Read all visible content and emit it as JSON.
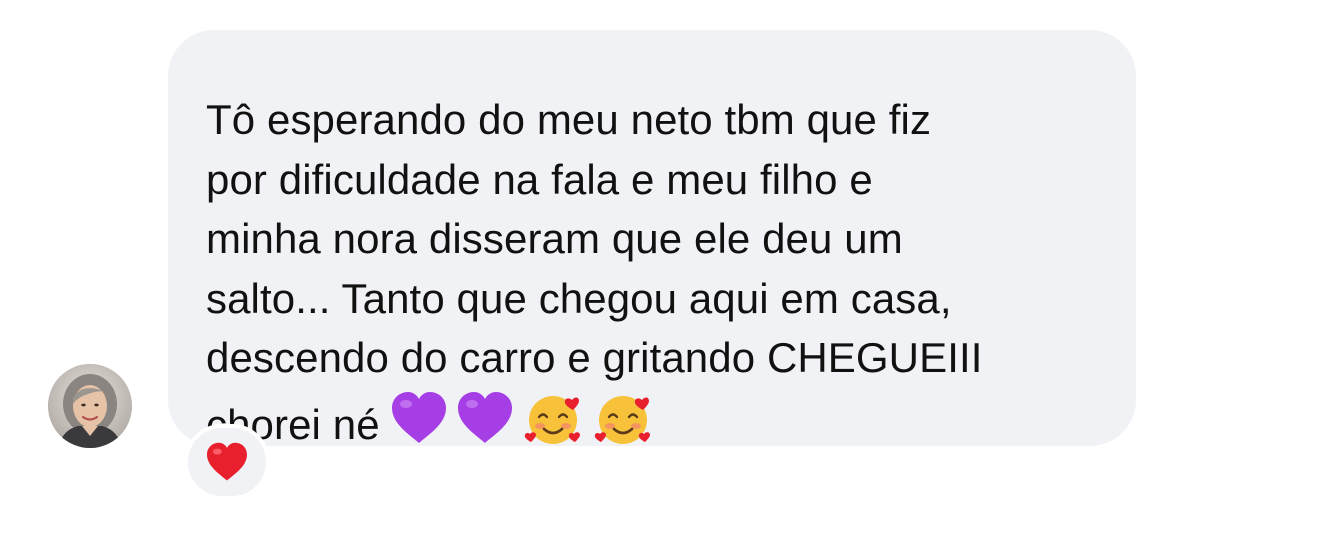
{
  "message": {
    "lines": [
      "Tô esperando do meu neto tbm que fiz",
      "por dificuldade na fala e meu filho e",
      "minha nora disseram que ele deu um",
      "salto... Tanto que chegou aqui em casa,",
      "descendo do carro e gritando CHEGUEIII",
      "chorei né"
    ],
    "emojis": [
      "purple-heart",
      "purple-heart",
      "smiling-face-with-hearts",
      "smiling-face-with-hearts"
    ]
  },
  "reaction": {
    "emoji": "red-heart"
  },
  "colors": {
    "bubble_background": "#f1f2f5",
    "text": "#111111",
    "purple_heart": "#a63ee6",
    "red_heart": "#e8202e",
    "smiley_face": "#f7c23a"
  }
}
